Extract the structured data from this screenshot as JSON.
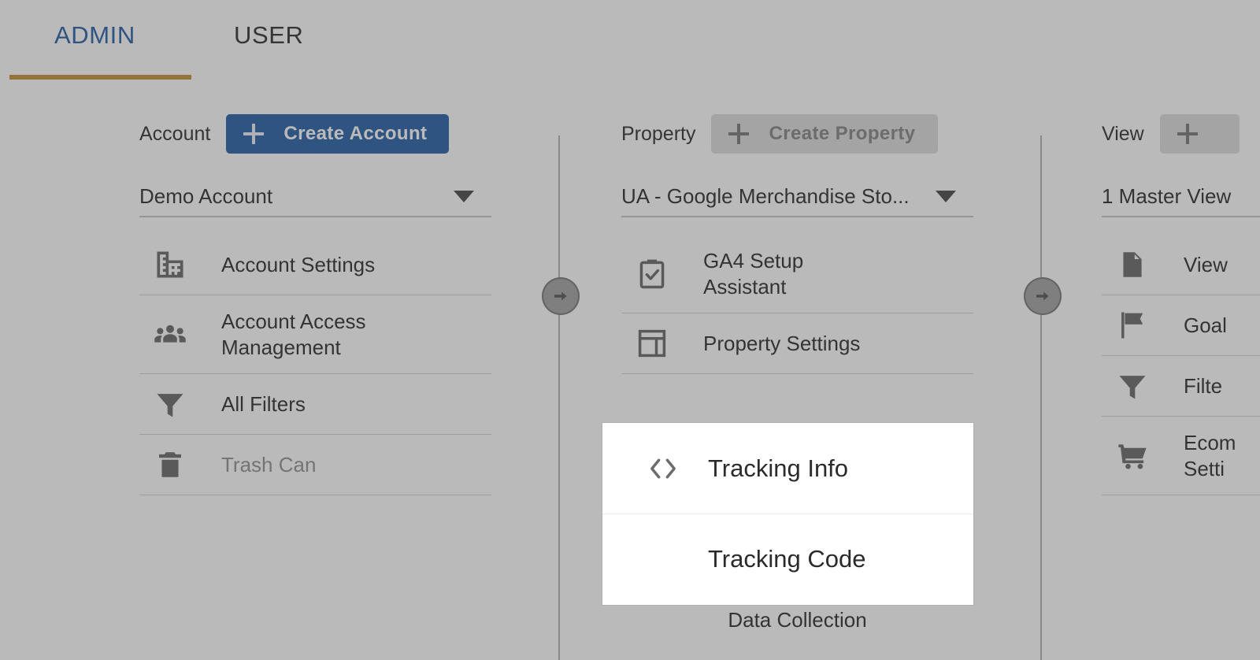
{
  "tabs": {
    "admin_label": "ADMIN",
    "user_label": "USER",
    "active": "ADMIN",
    "active_underline_color": "#c08a2b",
    "active_text_color": "#1a56a0"
  },
  "columns": [
    {
      "key": "account",
      "label": "Account",
      "create_button": {
        "label": "Create Account",
        "icon": "plus-icon",
        "enabled": true,
        "color": "#1a56a0"
      },
      "selector": {
        "value": "Demo Account",
        "icon": "chevron-down-icon"
      },
      "items": [
        {
          "label": "Account Settings",
          "icon": "building-icon",
          "muted": false
        },
        {
          "label": "Account Access\nManagement",
          "icon": "people-group-icon",
          "muted": false
        },
        {
          "label": "All Filters",
          "icon": "funnel-icon",
          "muted": false
        },
        {
          "label": "Trash Can",
          "icon": "trash-icon",
          "muted": true
        }
      ]
    },
    {
      "key": "property",
      "label": "Property",
      "create_button": {
        "label": "Create Property",
        "icon": "plus-icon",
        "enabled": false,
        "color": "#7d7d7d"
      },
      "selector": {
        "value": "UA - Google Merchandise Sto...",
        "icon": "chevron-down-icon"
      },
      "items": [
        {
          "label": "GA4 Setup\nAssistant",
          "icon": "clipboard-check-icon",
          "muted": false
        },
        {
          "label": "Property Settings",
          "icon": "layout-icon",
          "muted": false
        }
      ],
      "bottom_label": "Data Collection"
    },
    {
      "key": "view",
      "label": "View",
      "create_button": {
        "label": "",
        "icon": "plus-icon",
        "enabled": false,
        "color": "#7d7d7d"
      },
      "selector": {
        "value": "1 Master View",
        "icon": "chevron-down-icon"
      },
      "items": [
        {
          "label": "View",
          "icon": "document-icon",
          "muted": false
        },
        {
          "label": "Goal",
          "icon": "flag-icon",
          "muted": false
        },
        {
          "label": "Filte",
          "icon": "funnel-icon",
          "muted": false
        },
        {
          "label": "Ecom\nSetti",
          "icon": "cart-icon",
          "muted": false
        }
      ]
    }
  ],
  "transfer_arrows": [
    {
      "icon": "arrow-right-circle-icon"
    },
    {
      "icon": "arrow-right-circle-icon"
    }
  ],
  "spotlight": {
    "items": [
      {
        "label": "Tracking Info",
        "icon": "code-brackets-icon",
        "indent": false
      },
      {
        "label": "Tracking Code",
        "icon": "",
        "indent": true
      }
    ]
  }
}
